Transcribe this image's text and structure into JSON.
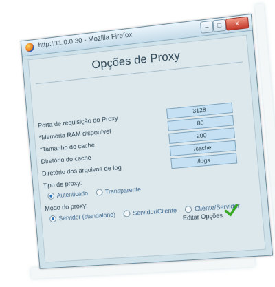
{
  "window": {
    "title": "http://11.0.0.30 - Mozilla Firefox",
    "buttons": {
      "minimize": "–",
      "maximize": "□",
      "close": "x"
    }
  },
  "page": {
    "heading": "Opções de Proxy"
  },
  "fields": [
    {
      "label": "Porta de requisição do Proxy",
      "value": "3128"
    },
    {
      "label": "*Memória RAM disponível",
      "value": "80"
    },
    {
      "label": "*Tamanho do cache",
      "value": "200"
    },
    {
      "label": "Diretório do cache",
      "value": "/cache"
    },
    {
      "label": "Diretório dos arquivos de log",
      "value": "/logs"
    }
  ],
  "proxy_type": {
    "label": "Tipo de proxy:",
    "options": [
      {
        "label": "Autenticado",
        "selected": true
      },
      {
        "label": "Transparente",
        "selected": false
      }
    ]
  },
  "proxy_mode": {
    "label": "Modo do proxy:",
    "options": [
      {
        "label": "Servidor (standalone)",
        "selected": true
      },
      {
        "label": "Servidor/Cliente",
        "selected": false
      },
      {
        "label": "Cliente/Servidor",
        "selected": false
      }
    ]
  },
  "actions": {
    "edit_options": "Editar Opções"
  },
  "colors": {
    "window_bg": "#cfe2ea",
    "input_bg": "#c5e0f2",
    "check": "#35a81f",
    "close_button": "#c4392a"
  },
  "icons": {
    "app": "firefox-icon",
    "confirm": "check-icon"
  }
}
